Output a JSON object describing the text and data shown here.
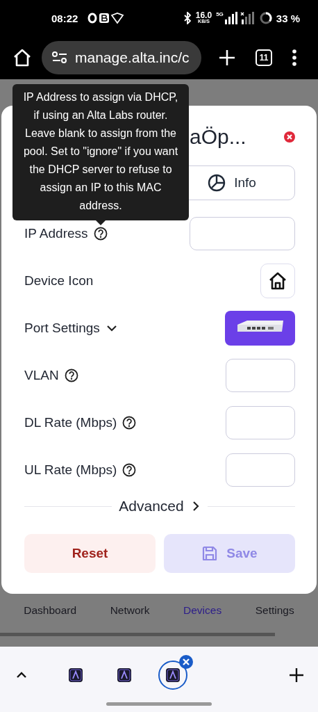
{
  "status_bar": {
    "time": "08:22",
    "speed": "16.0",
    "speed_unit": "KB/S",
    "network": "5G",
    "battery": "33 %"
  },
  "browser": {
    "url": "manage.alta.inc/c",
    "tab_count": "11"
  },
  "tooltip": {
    "text": "IP Address to assign via DHCP, if using an Alta Labs router. Leave blank to assign from the pool. Set to \"ignore\" if you want the DHCP server to refuse to assign an IP to this MAC address."
  },
  "dialog": {
    "title": "aÖp...",
    "tabs": [
      {
        "label": "Info",
        "selected": false
      }
    ],
    "fields": [
      {
        "kind": "input",
        "label": "IP Address",
        "help": true,
        "wide": true
      },
      {
        "kind": "icon",
        "label": "Device Icon",
        "help": false
      },
      {
        "kind": "port",
        "label": "Port Settings",
        "help": false
      },
      {
        "kind": "input",
        "label": "VLAN",
        "help": true,
        "wide": false
      },
      {
        "kind": "input",
        "label": "DL Rate (Mbps)",
        "help": true,
        "wide": false
      },
      {
        "kind": "input",
        "label": "UL Rate (Mbps)",
        "help": true,
        "wide": false
      }
    ],
    "advanced": "Advanced",
    "reset": "Reset",
    "save": {
      "label": "Save",
      "disabled": true
    }
  },
  "bottom_nav": [
    {
      "label": "Dashboard",
      "selected": false
    },
    {
      "label": "Network",
      "selected": false
    },
    {
      "label": "Devices",
      "selected": true
    },
    {
      "label": "Settings",
      "selected": false
    }
  ],
  "tab_strip": [
    {
      "selected": false
    },
    {
      "selected": false
    },
    {
      "selected": true
    }
  ]
}
